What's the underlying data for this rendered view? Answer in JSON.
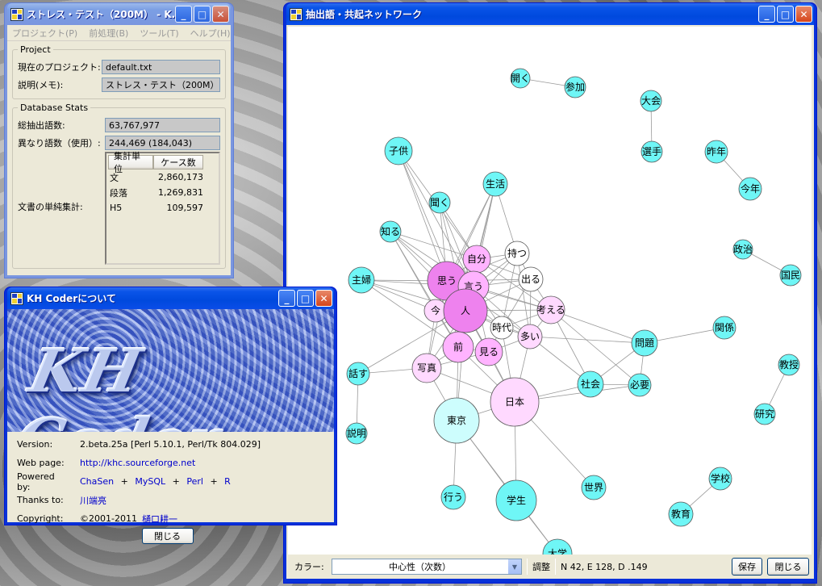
{
  "project_window": {
    "title": "ストレス・テスト（200M） - K...",
    "menu": [
      "プロジェクト(P)",
      "前処理(B)",
      "ツール(T)",
      "ヘルプ(H)"
    ],
    "project_group": {
      "legend": "Project",
      "current_label": "現在のプロジェクト:",
      "current_value": "default.txt",
      "memo_label": "説明(メモ):",
      "memo_value": "ストレス・テスト（200M）"
    },
    "stats_group": {
      "legend": "Database Stats",
      "total_label": "総抽出語数:",
      "total_value": "63,767,977",
      "distinct_label": "異なり語数（使用）:",
      "distinct_value": "244,469 (184,043)",
      "doc_label": "文書の単純集計:",
      "table_headers": [
        "集計単位",
        "ケース数"
      ],
      "table_rows": [
        {
          "unit": "文",
          "count": "2,860,173"
        },
        {
          "unit": "段落",
          "count": "1,269,831"
        },
        {
          "unit": "H5",
          "count": "109,597"
        }
      ]
    }
  },
  "about_window": {
    "title": "KH Coderについて",
    "banner_text": "KH Coder",
    "version_label": "Version:",
    "version_value": "2.beta.25a  [Perl 5.10.1, Perl/Tk 804.029]",
    "webpage_label": "Web page:",
    "webpage_value": "http://khc.sourceforge.net",
    "powered_label": "Powered by:",
    "powered_items": [
      "ChaSen",
      "MySQL",
      "Perl",
      "R"
    ],
    "powered_sep": "+",
    "thanks_label": "Thanks to:",
    "thanks_value": "川端亮",
    "copyright_label": "Copyright:",
    "copyright_year": "©2001-2011",
    "copyright_name": "樋口耕一",
    "close_button": "閉じる"
  },
  "network_window": {
    "title": "抽出語・共起ネットワーク",
    "color_label": "カラー:",
    "color_value": "中心性（次数）",
    "adjust_button": "調整",
    "stats_text": "N 42, E 128, D .149",
    "save_button": "保存",
    "close_button": "閉じる",
    "colors": {
      "high": "#ee82ee",
      "mid": "#ffb3ff",
      "low": "#ffd9ff",
      "white": "#ffffff",
      "lightcyan": "#cdfdfd",
      "cyan": "#6ff6f6"
    },
    "nodes": [
      {
        "id": "開く",
        "color": "cyan"
      },
      {
        "id": "参加",
        "color": "cyan"
      },
      {
        "id": "大会",
        "color": "cyan"
      },
      {
        "id": "選手",
        "color": "cyan"
      },
      {
        "id": "昨年",
        "color": "cyan"
      },
      {
        "id": "今年",
        "color": "cyan"
      },
      {
        "id": "政治",
        "color": "cyan"
      },
      {
        "id": "国民",
        "color": "cyan"
      },
      {
        "id": "子供",
        "color": "cyan"
      },
      {
        "id": "生活",
        "color": "cyan"
      },
      {
        "id": "聞く",
        "color": "cyan"
      },
      {
        "id": "知る",
        "color": "cyan"
      },
      {
        "id": "主婦",
        "color": "cyan"
      },
      {
        "id": "自分",
        "color": "mid"
      },
      {
        "id": "持つ",
        "color": "white"
      },
      {
        "id": "思う",
        "color": "high"
      },
      {
        "id": "言う",
        "color": "mid"
      },
      {
        "id": "出る",
        "color": "white"
      },
      {
        "id": "今",
        "color": "low"
      },
      {
        "id": "人",
        "color": "high"
      },
      {
        "id": "考える",
        "color": "low"
      },
      {
        "id": "時代",
        "color": "white"
      },
      {
        "id": "多い",
        "color": "low"
      },
      {
        "id": "関係",
        "color": "cyan"
      },
      {
        "id": "前",
        "color": "mid"
      },
      {
        "id": "見る",
        "color": "mid"
      },
      {
        "id": "問題",
        "color": "cyan"
      },
      {
        "id": "写真",
        "color": "low"
      },
      {
        "id": "話す",
        "color": "cyan"
      },
      {
        "id": "社会",
        "color": "cyan"
      },
      {
        "id": "必要",
        "color": "cyan"
      },
      {
        "id": "教授",
        "color": "cyan"
      },
      {
        "id": "日本",
        "color": "low"
      },
      {
        "id": "東京",
        "color": "lightcyan"
      },
      {
        "id": "研究",
        "color": "cyan"
      },
      {
        "id": "説明",
        "color": "cyan"
      },
      {
        "id": "学校",
        "color": "cyan"
      },
      {
        "id": "世界",
        "color": "cyan"
      },
      {
        "id": "行う",
        "color": "cyan"
      },
      {
        "id": "学生",
        "color": "cyan"
      },
      {
        "id": "教育",
        "color": "cyan"
      },
      {
        "id": "大学",
        "color": "cyan"
      }
    ]
  }
}
